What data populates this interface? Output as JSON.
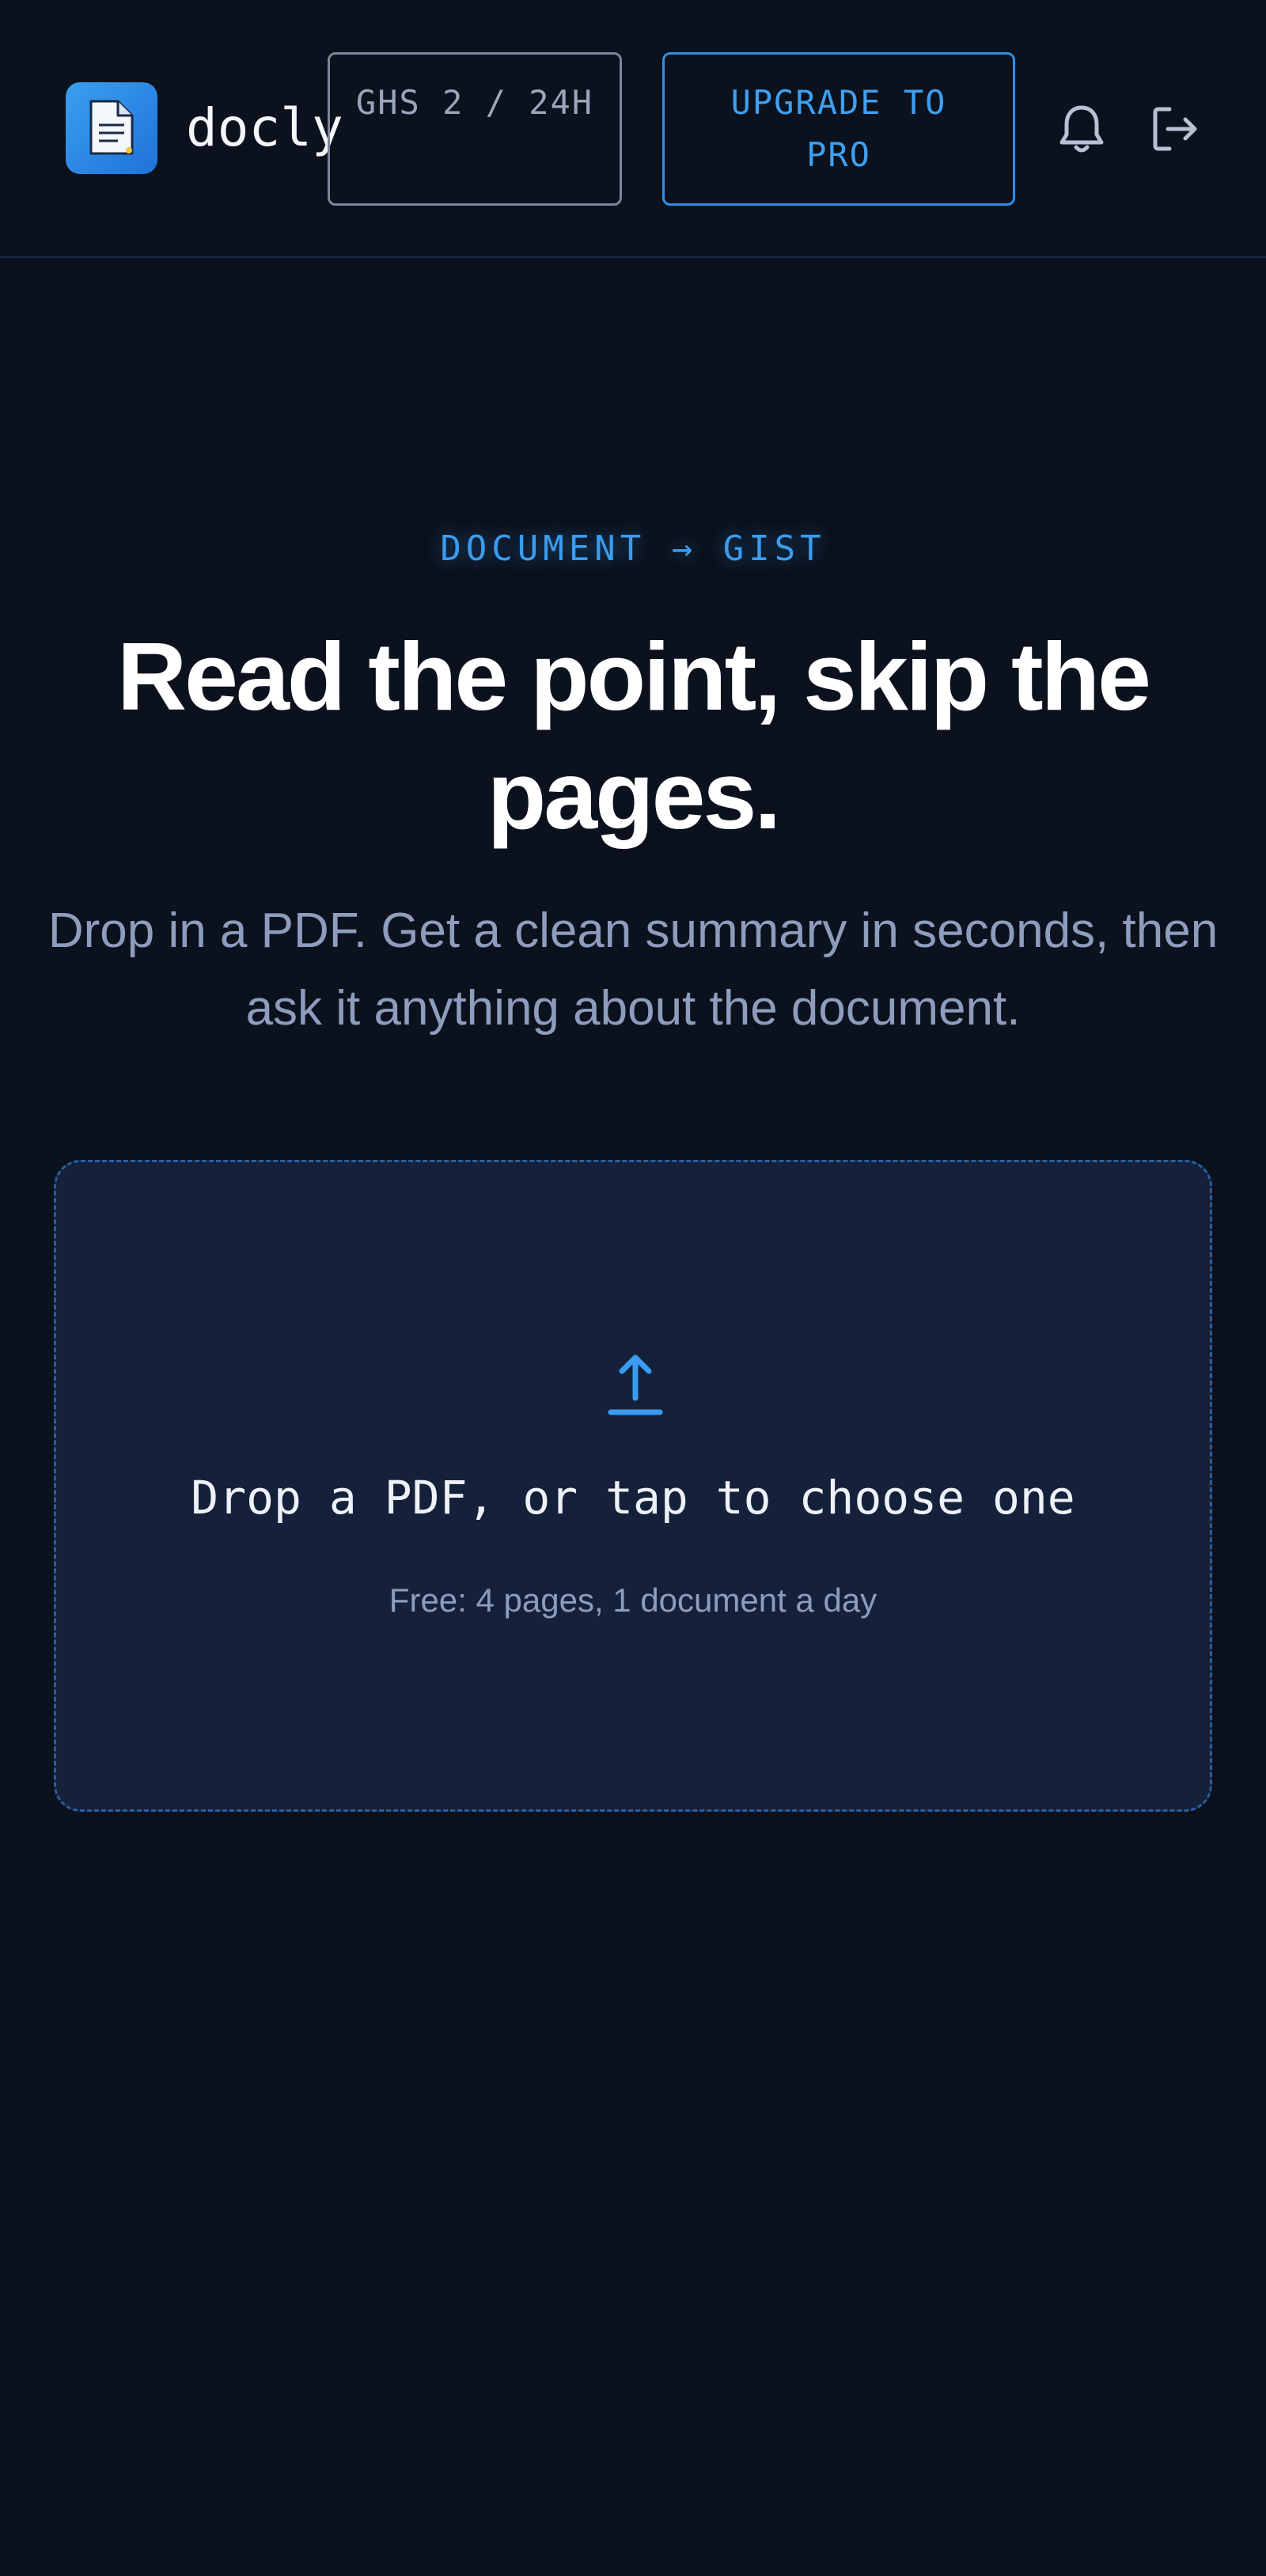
{
  "header": {
    "brand": "docly",
    "logo_icon": "document-icon",
    "credits_label": "GHS 2 / 24H",
    "upgrade_label": "UPGRADE TO PRO",
    "bell_icon": "bell-icon",
    "logout_icon": "logout-icon"
  },
  "hero": {
    "eyebrow": "DOCUMENT → GIST",
    "headline": "Read the point, skip the pages.",
    "subhead": "Drop in a PDF. Get a clean summary in seconds, then ask it anything about the document."
  },
  "upload": {
    "icon": "upload-icon",
    "title": "Drop a PDF, or tap to choose one",
    "note": "Free: 4 pages, 1 document a day"
  },
  "colors": {
    "background": "#0b111d",
    "accent": "#3a9cf0",
    "panel": "#15213a",
    "muted_text": "#8e9cbd"
  }
}
